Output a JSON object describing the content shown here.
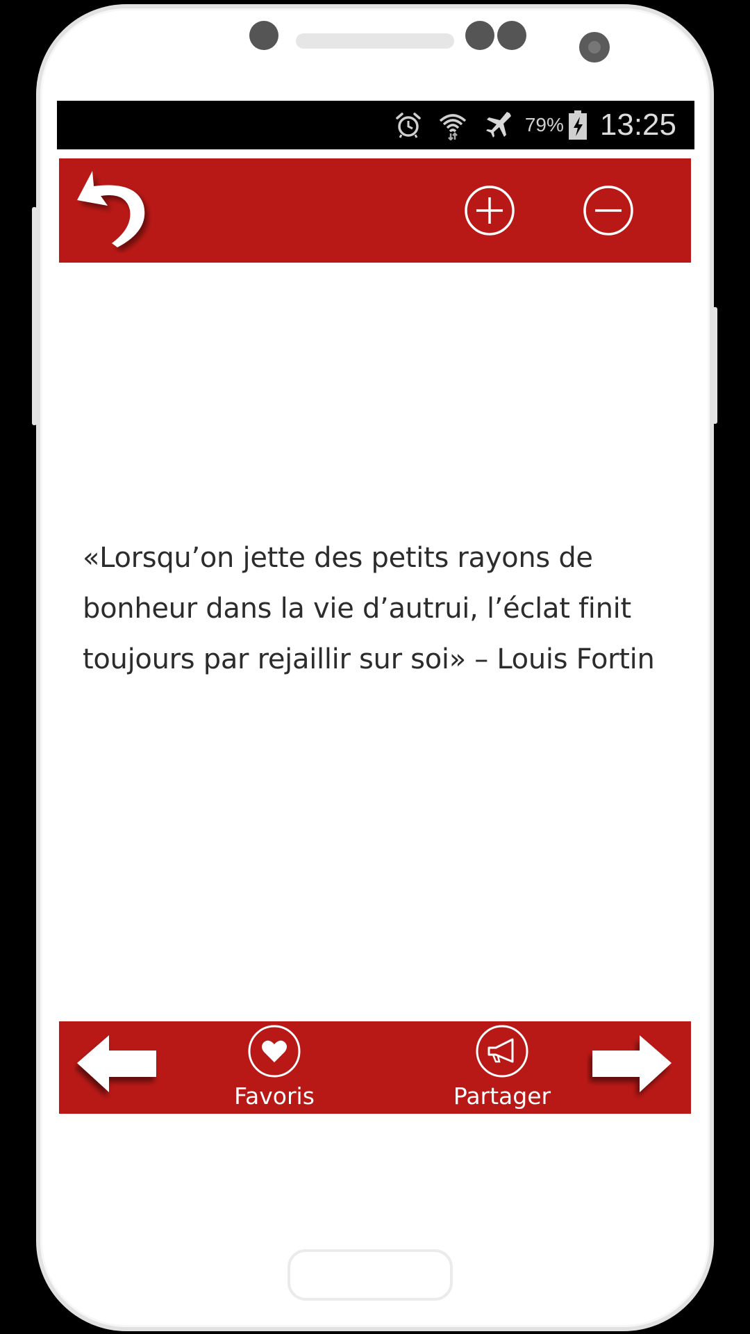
{
  "status_bar": {
    "battery_percent": "79%",
    "time": "13:25",
    "icons": [
      "alarm-icon",
      "wifi-icon",
      "airplane-icon",
      "battery-charging-icon"
    ]
  },
  "toolbar": {
    "background_color": "#b91916",
    "buttons": [
      "back-arrow-icon",
      "zoom-in-icon",
      "zoom-out-icon"
    ]
  },
  "quote": {
    "text": "«Lorsqu’on jette des petits rayons de bonheur dans la vie d’autrui, l’éclat finit toujours par rejaillir sur soi» – Louis Fortin"
  },
  "bottom_bar": {
    "background_color": "#b91916",
    "favorites_label": "Favoris",
    "share_label": "Partager",
    "icons": [
      "previous-arrow-icon",
      "heart-icon",
      "megaphone-icon",
      "next-arrow-icon"
    ]
  }
}
